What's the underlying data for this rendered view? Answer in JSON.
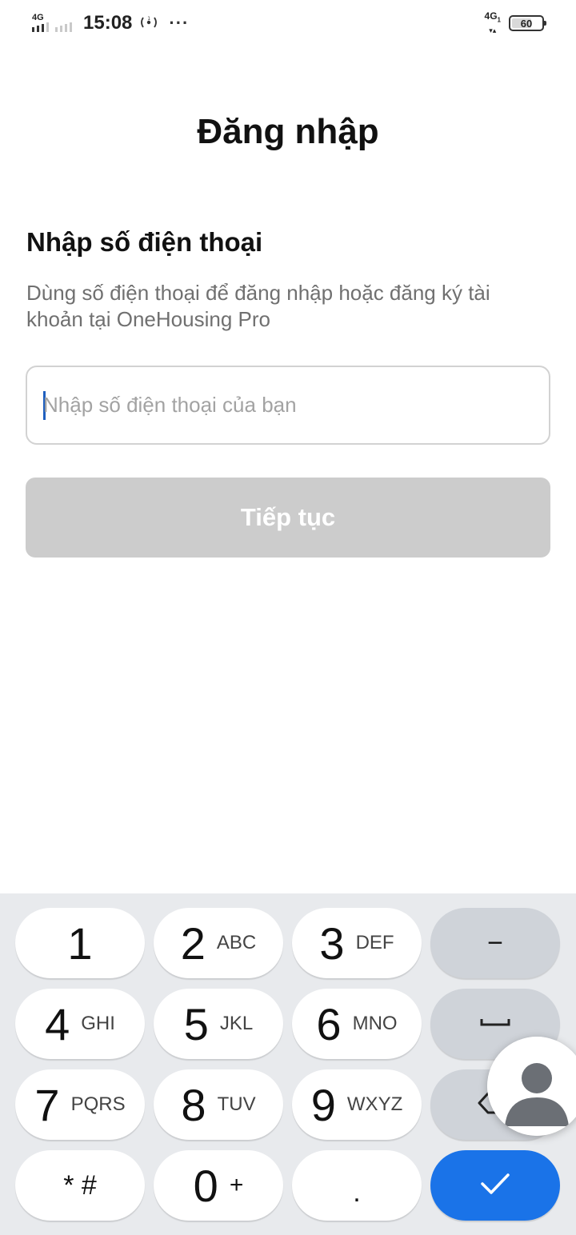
{
  "status_bar": {
    "network_left": "4G",
    "time": "15:08",
    "network_right": "4G",
    "network_right_sub": "1",
    "battery": "60",
    "hotspot_icon": "hotspot-icon",
    "more_icon": "more-icon"
  },
  "header": {
    "title": "Đăng nhập"
  },
  "form": {
    "section_title": "Nhập số điện thoại",
    "description": "Dùng số điện thoại để đăng nhập hoặc đăng ký tài khoản tại OneHousing Pro",
    "phone_placeholder": "Nhập số điện thoại của bạn",
    "phone_value": "",
    "continue_label": "Tiếp tục"
  },
  "keyboard": {
    "keys": [
      {
        "digit": "1",
        "letters": ""
      },
      {
        "digit": "2",
        "letters": "ABC"
      },
      {
        "digit": "3",
        "letters": "DEF"
      },
      {
        "digit": "4",
        "letters": "GHI"
      },
      {
        "digit": "5",
        "letters": "JKL"
      },
      {
        "digit": "6",
        "letters": "MNO"
      },
      {
        "digit": "7",
        "letters": "PQRS"
      },
      {
        "digit": "8",
        "letters": "TUV"
      },
      {
        "digit": "9",
        "letters": "WXYZ"
      },
      {
        "digit": "0",
        "letters": "+"
      }
    ],
    "star_hash": "* #",
    "dot": ".",
    "minus": "−",
    "icons": [
      "space-icon",
      "backspace-icon",
      "check-icon"
    ],
    "accent_color": "#1a73e8"
  },
  "colors": {
    "button_disabled": "#cccccc",
    "input_border": "#d2d2d2",
    "keyboard_bg": "#e8eaed"
  }
}
